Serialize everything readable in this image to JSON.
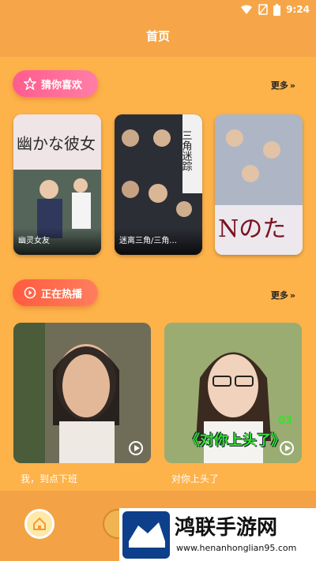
{
  "status_bar": {
    "time": "9:24"
  },
  "header": {
    "title": "首页"
  },
  "section_recommend": {
    "label": "猜你喜欢",
    "more": "更多",
    "items": [
      {
        "title": "幽灵女友",
        "poster_text": "幽かな彼女"
      },
      {
        "title": "迷离三角/三角...",
        "poster_text": "三角迷踪"
      },
      {
        "title": "",
        "poster_text": "Nのた"
      }
    ]
  },
  "section_hot": {
    "label": "正在热播",
    "more": "更多",
    "items": [
      {
        "title": "我，到点下班"
      },
      {
        "title": "对你上头了",
        "badge": "《对你上头了》",
        "badge_num": "03"
      }
    ]
  },
  "watermark": {
    "name": "鸿联手游网",
    "url": "www.henanhonglian95.com"
  },
  "colors": {
    "bg": "#FDB24A",
    "pink": "#FF5C8F",
    "orange": "#FF5B3F"
  }
}
